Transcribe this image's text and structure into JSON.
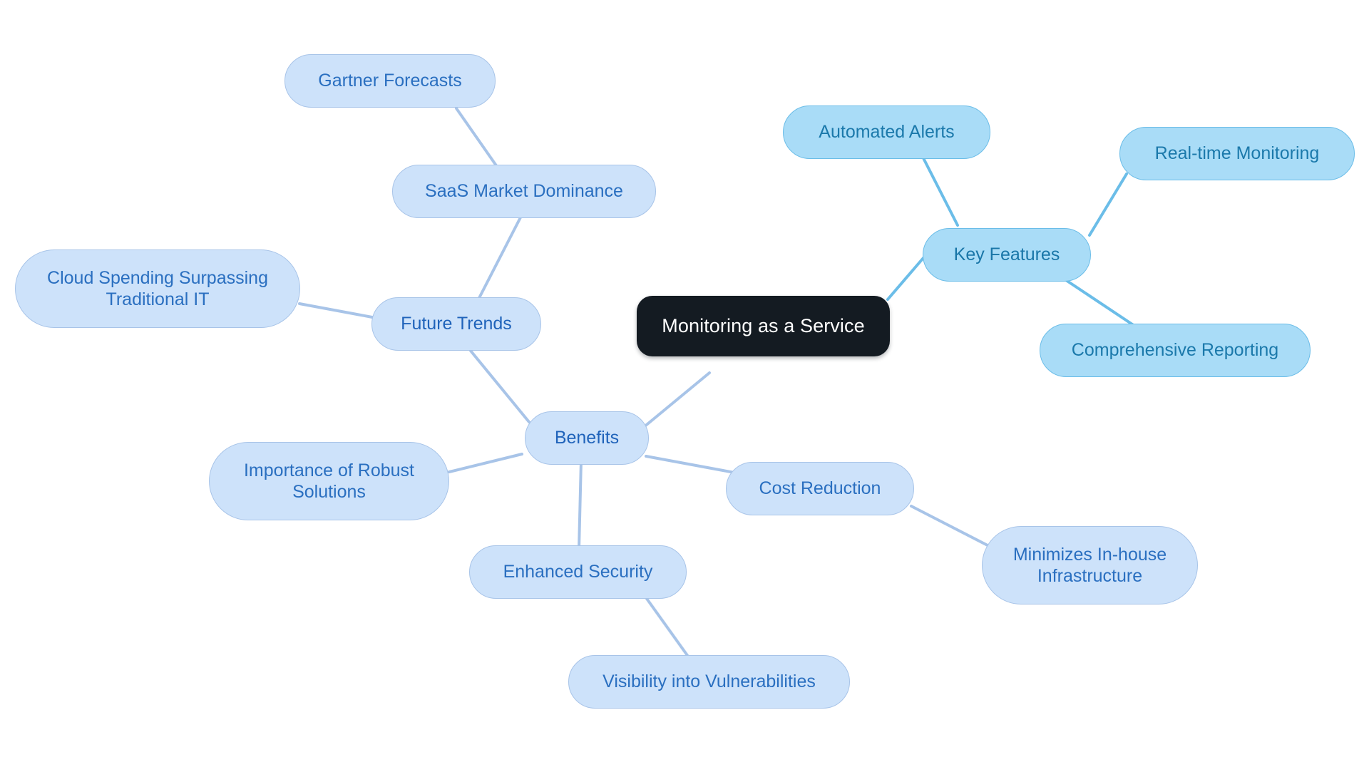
{
  "diagram": {
    "type": "mindmap",
    "title": "Monitoring as a Service",
    "background": "#ffffff",
    "colors": {
      "root_fill": "#141b22",
      "root_text": "#ffffff",
      "bright_fill": "#a9dcf7",
      "bright_border": "#6bbde8",
      "bright_text": "#1b79ab",
      "soft_fill": "#cde2fa",
      "soft_border": "#a8c4e8",
      "soft_text": "#2a6fc0",
      "edge_bright": "#6bbde8",
      "edge_soft": "#a8c4e8"
    },
    "nodes": {
      "root": {
        "label": "Monitoring as a Service"
      },
      "key_features": {
        "label": "Key Features"
      },
      "automated_alerts": {
        "label": "Automated Alerts"
      },
      "realtime_monitoring": {
        "label": "Real-time Monitoring"
      },
      "comprehensive_reporting": {
        "label": "Comprehensive Reporting"
      },
      "benefits": {
        "label": "Benefits"
      },
      "cost_reduction": {
        "label": "Cost Reduction"
      },
      "minimizes_infrastructure": {
        "label": "Minimizes In-house\nInfrastructure"
      },
      "enhanced_security": {
        "label": "Enhanced Security"
      },
      "visibility_vulnerabilities": {
        "label": "Visibility into Vulnerabilities"
      },
      "importance_robust": {
        "label": "Importance of Robust\nSolutions"
      },
      "future_trends": {
        "label": "Future Trends"
      },
      "saas_market": {
        "label": "SaaS Market Dominance"
      },
      "gartner_forecasts": {
        "label": "Gartner Forecasts"
      },
      "cloud_spending": {
        "label": "Cloud Spending Surpassing\nTraditional IT"
      }
    },
    "edges": [
      {
        "from": "root",
        "to": "key_features",
        "color": "#6bbde8"
      },
      {
        "from": "key_features",
        "to": "automated_alerts",
        "color": "#6bbde8"
      },
      {
        "from": "key_features",
        "to": "realtime_monitoring",
        "color": "#6bbde8"
      },
      {
        "from": "key_features",
        "to": "comprehensive_reporting",
        "color": "#6bbde8"
      },
      {
        "from": "root",
        "to": "benefits",
        "color": "#a8c4e8"
      },
      {
        "from": "benefits",
        "to": "cost_reduction",
        "color": "#a8c4e8"
      },
      {
        "from": "cost_reduction",
        "to": "minimizes_infrastructure",
        "color": "#a8c4e8"
      },
      {
        "from": "benefits",
        "to": "enhanced_security",
        "color": "#a8c4e8"
      },
      {
        "from": "enhanced_security",
        "to": "visibility_vulnerabilities",
        "color": "#a8c4e8"
      },
      {
        "from": "benefits",
        "to": "importance_robust",
        "color": "#a8c4e8"
      },
      {
        "from": "benefits",
        "to": "future_trends",
        "color": "#a8c4e8"
      },
      {
        "from": "future_trends",
        "to": "saas_market",
        "color": "#a8c4e8"
      },
      {
        "from": "saas_market",
        "to": "gartner_forecasts",
        "color": "#a8c4e8"
      },
      {
        "from": "future_trends",
        "to": "cloud_spending",
        "color": "#a8c4e8"
      }
    ]
  }
}
